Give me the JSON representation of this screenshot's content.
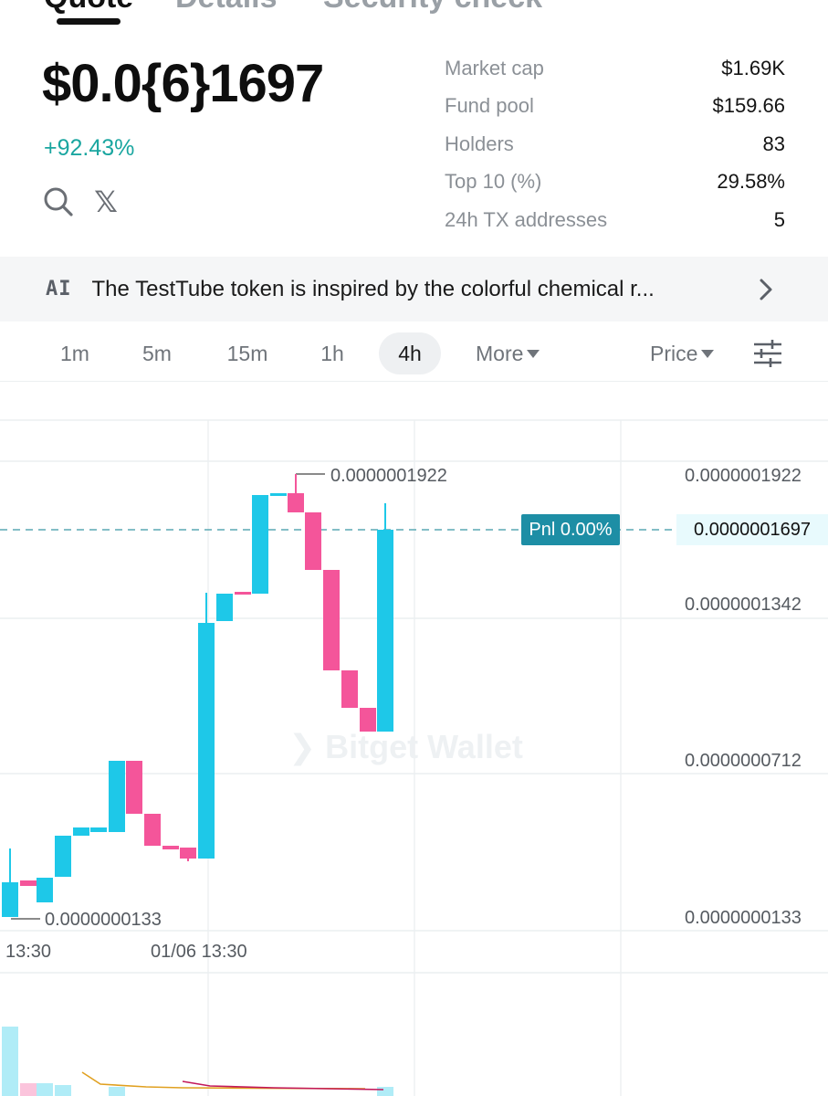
{
  "tabs": [
    {
      "label": "Quote",
      "active": true
    },
    {
      "label": "Details",
      "active": false
    },
    {
      "label": "Security check",
      "active": false
    }
  ],
  "quote": {
    "price": "$0.0{6}1697",
    "change": "+92.43%",
    "icons": [
      "search-icon",
      "x-icon"
    ]
  },
  "stats": [
    {
      "label": "Market cap",
      "value": "$1.69K"
    },
    {
      "label": "Fund pool",
      "value": "$159.66"
    },
    {
      "label": "Holders",
      "value": "83"
    },
    {
      "label": "Top 10 (%)",
      "value": "29.58%"
    },
    {
      "label": "24h TX addresses",
      "value": "5"
    }
  ],
  "ai_banner": {
    "icon": "AI",
    "text": "The TestTube token is inspired by the colorful chemical r..."
  },
  "timeframes": [
    {
      "label": "1m",
      "active": false
    },
    {
      "label": "5m",
      "active": false
    },
    {
      "label": "15m",
      "active": false
    },
    {
      "label": "1h",
      "active": false
    },
    {
      "label": "4h",
      "active": true
    }
  ],
  "more_label": "More",
  "price_mode_label": "Price",
  "chart": {
    "watermark": "Bitget Wallet",
    "pnl_label": "Pnl 0.00%",
    "current_price": "0.0000001697",
    "high_label": "0.0000001922",
    "low_label": "0.0000000133",
    "y_axis": [
      "0.0000001922",
      "0.0000001342",
      "0.0000000712",
      "0.0000000133"
    ],
    "x_axis": [
      "13:30",
      "01/06 13:30"
    ],
    "colors": {
      "up": "#1ec8e8",
      "down": "#f4559a",
      "pnl": "#1d8ea5"
    }
  }
}
